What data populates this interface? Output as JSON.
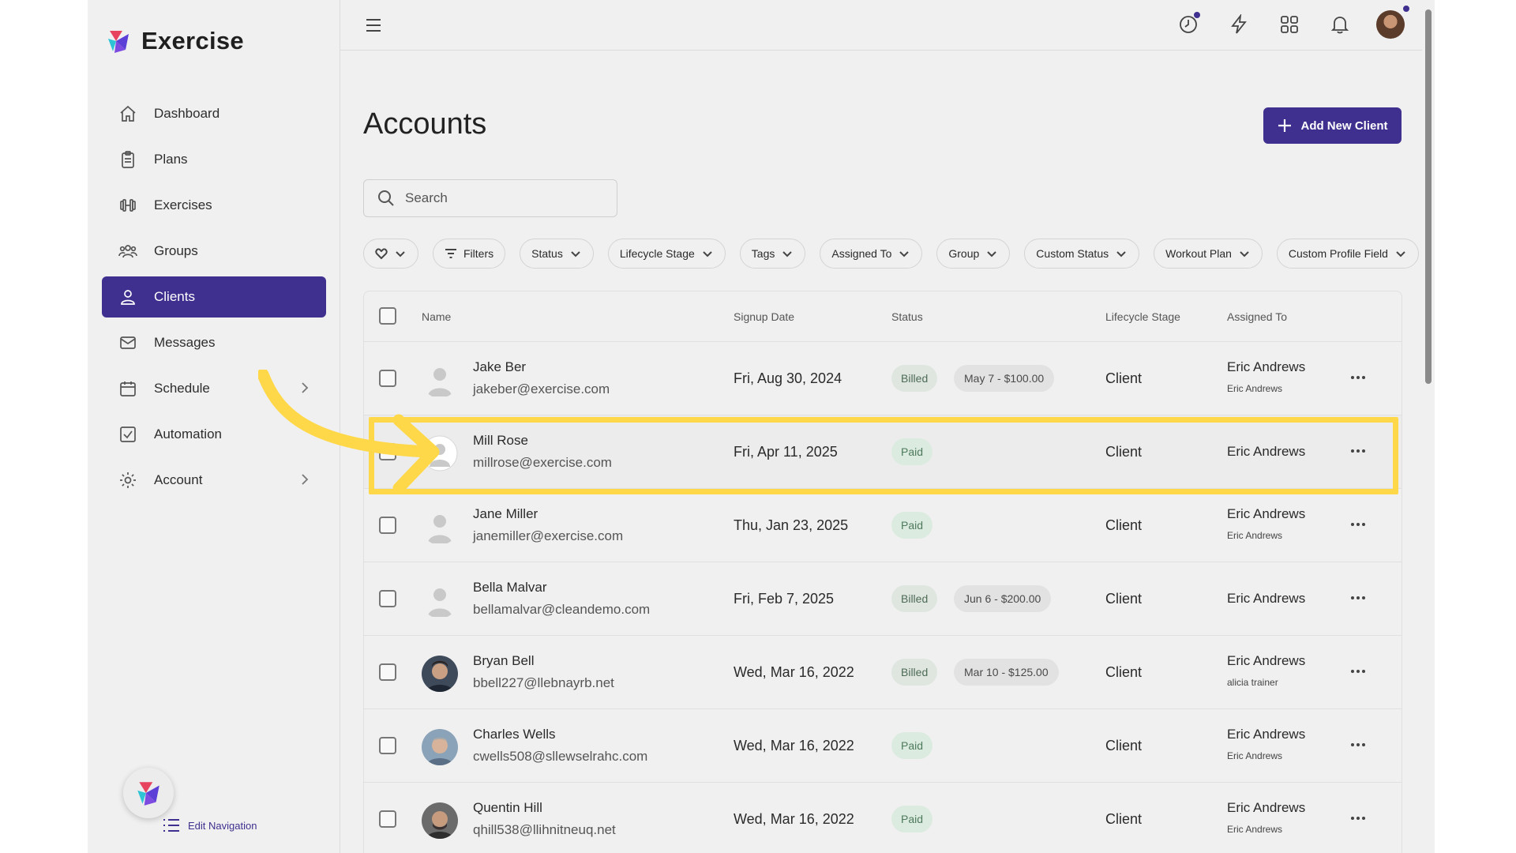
{
  "app": {
    "name": "Exercise"
  },
  "colors": {
    "accent": "#3f2f8e",
    "highlight": "#ffd84a",
    "paid": "#dcebe0",
    "billed": "#dfe6e0"
  },
  "sidebar": {
    "items": [
      {
        "label": "Dashboard",
        "icon": "home-icon"
      },
      {
        "label": "Plans",
        "icon": "clipboard-icon"
      },
      {
        "label": "Exercises",
        "icon": "dumbbell-icon"
      },
      {
        "label": "Groups",
        "icon": "group-icon"
      },
      {
        "label": "Clients",
        "icon": "user-icon",
        "active": true
      },
      {
        "label": "Messages",
        "icon": "mail-icon"
      },
      {
        "label": "Schedule",
        "icon": "calendar-icon",
        "expandable": true
      },
      {
        "label": "Automation",
        "icon": "check-square-icon"
      },
      {
        "label": "Account",
        "icon": "gear-icon",
        "expandable": true
      }
    ],
    "edit_navigation": "Edit Navigation"
  },
  "page": {
    "title": "Accounts",
    "add_button": "Add New Client",
    "search_placeholder": "Search"
  },
  "filters": [
    "Filters",
    "Status",
    "Lifecycle Stage",
    "Tags",
    "Assigned To",
    "Group",
    "Custom Status",
    "Workout Plan",
    "Custom Profile Field"
  ],
  "table": {
    "headers": {
      "name": "Name",
      "signup": "Signup Date",
      "status": "Status",
      "stage": "Lifecycle Stage",
      "assigned": "Assigned To"
    },
    "rows": [
      {
        "name": "Jake Ber",
        "email": "jakeber@exercise.com",
        "signup": "Fri, Aug 30, 2024",
        "status": "Billed",
        "billing": "May 7 - $100.00",
        "stage": "Client",
        "assigned": "Eric Andrews",
        "assigned_sub": "Eric Andrews"
      },
      {
        "name": "Mill Rose",
        "email": "millrose@exercise.com",
        "signup": "Fri, Apr 11, 2025",
        "status": "Paid",
        "billing": "",
        "stage": "Client",
        "assigned": "Eric Andrews",
        "assigned_sub": "",
        "highlighted": true
      },
      {
        "name": "Jane Miller",
        "email": "janemiller@exercise.com",
        "signup": "Thu, Jan 23, 2025",
        "status": "Paid",
        "billing": "",
        "stage": "Client",
        "assigned": "Eric Andrews",
        "assigned_sub": "Eric Andrews"
      },
      {
        "name": "Bella Malvar",
        "email": "bellamalvar@cleandemo.com",
        "signup": "Fri, Feb 7, 2025",
        "status": "Billed",
        "billing": "Jun 6 - $200.00",
        "stage": "Client",
        "assigned": "Eric Andrews",
        "assigned_sub": ""
      },
      {
        "name": "Bryan Bell",
        "email": "bbell227@llebnayrb.net",
        "signup": "Wed, Mar 16, 2022",
        "status": "Billed",
        "billing": "Mar 10 - $125.00",
        "stage": "Client",
        "assigned": "Eric Andrews",
        "assigned_sub": "alicia trainer"
      },
      {
        "name": "Charles Wells",
        "email": "cwells508@sllewselrahc.com",
        "signup": "Wed, Mar 16, 2022",
        "status": "Paid",
        "billing": "",
        "stage": "Client",
        "assigned": "Eric Andrews",
        "assigned_sub": "Eric Andrews"
      },
      {
        "name": "Quentin Hill",
        "email": "qhill538@llihnitneuq.net",
        "signup": "Wed, Mar 16, 2022",
        "status": "Paid",
        "billing": "",
        "stage": "Client",
        "assigned": "Eric Andrews",
        "assigned_sub": "Eric Andrews"
      }
    ]
  }
}
